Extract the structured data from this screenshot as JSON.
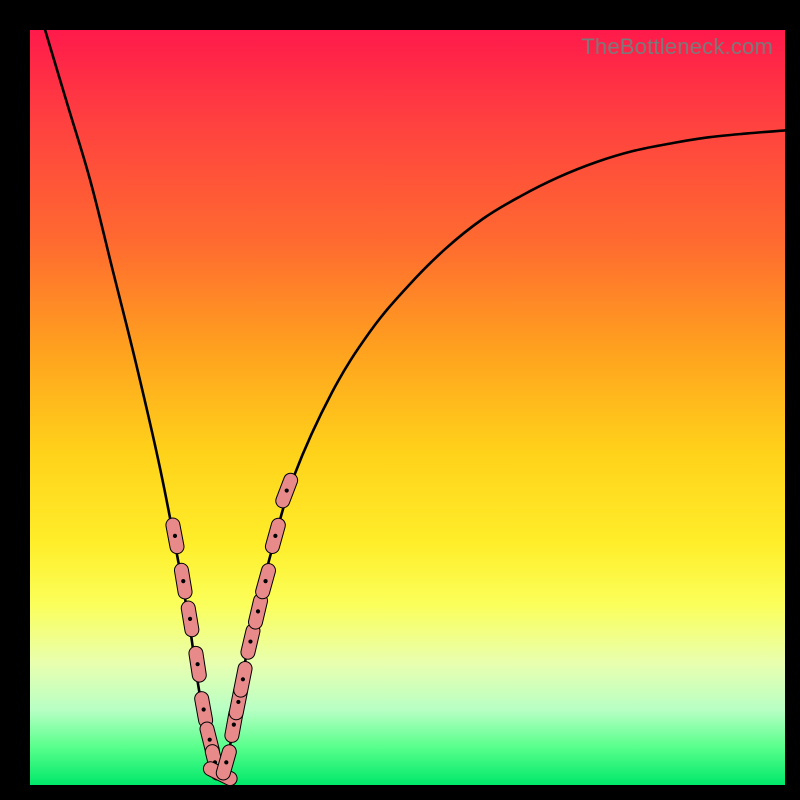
{
  "watermark": "TheBottleneck.com",
  "colors": {
    "frame": "#000000",
    "curve": "#000000",
    "marker_fill": "#e88a8a",
    "marker_stroke": "#000000",
    "gradient_stops": [
      "#ff1a4b",
      "#ff4040",
      "#ff6a30",
      "#ffa01f",
      "#ffd21a",
      "#ffee2a",
      "#fbff5a",
      "#e8ffb0",
      "#b8ffc4",
      "#58ff8c",
      "#00e86a"
    ]
  },
  "chart_data": {
    "type": "line",
    "title": "",
    "xlabel": "",
    "ylabel": "",
    "xlim": [
      0,
      100
    ],
    "ylim": [
      0,
      100
    ],
    "x_bottleneck_min": 25,
    "comment": "V-shaped bottleneck curve. y is percentage bottleneck; minimum near x≈25. Values estimated from pixel positions.",
    "series": [
      {
        "name": "bottleneck-curve",
        "x": [
          2,
          5,
          8,
          11,
          14,
          17,
          19,
          21,
          22,
          23,
          24,
          25,
          26,
          27,
          28,
          30,
          32,
          35,
          40,
          45,
          50,
          55,
          60,
          65,
          70,
          75,
          80,
          85,
          90,
          95,
          100
        ],
        "y": [
          100,
          90,
          80,
          68,
          56,
          43,
          33,
          22,
          15,
          9,
          4,
          1,
          3,
          8,
          14,
          23,
          31,
          41,
          52,
          60,
          66,
          71,
          75,
          78,
          80.5,
          82.5,
          84,
          85,
          85.8,
          86.3,
          86.7
        ]
      }
    ],
    "markers": {
      "name": "highlighted-points",
      "comment": "Salmon capsule markers clustered around the valley on both branches.",
      "x": [
        19.2,
        20.3,
        21.2,
        22.2,
        23.0,
        23.8,
        24.5,
        25.2,
        26.0,
        27.0,
        27.6,
        28.2,
        29.2,
        30.2,
        31.2,
        32.5,
        34.0
      ],
      "y": [
        33,
        27,
        22,
        16,
        10,
        6,
        3,
        1.5,
        3,
        8,
        11,
        14,
        19,
        23,
        27,
        33,
        39
      ]
    }
  }
}
